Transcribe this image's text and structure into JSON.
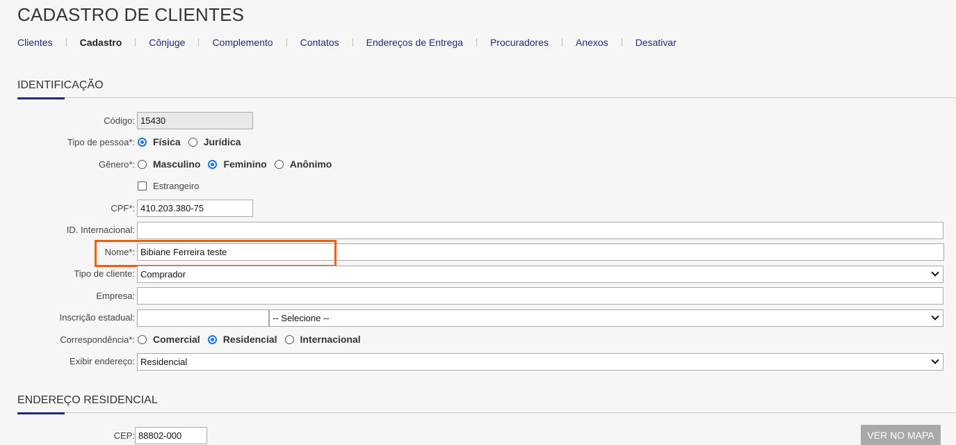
{
  "page": {
    "title": "CADASTRO DE CLIENTES"
  },
  "tabs": [
    {
      "label": "Clientes"
    },
    {
      "label": "Cadastro"
    },
    {
      "label": "Cônjuge"
    },
    {
      "label": "Complemento"
    },
    {
      "label": "Contatos"
    },
    {
      "label": "Endereços de Entrega"
    },
    {
      "label": "Procuradores"
    },
    {
      "label": "Anexos"
    },
    {
      "label": "Desativar"
    }
  ],
  "active_tab": "Cadastro",
  "identificacao": {
    "title": "IDENTIFICAÇÃO",
    "codigo": {
      "label": "Código:",
      "value": "15430"
    },
    "tipo_pessoa": {
      "label": "Tipo de pessoa*:",
      "options": [
        "Física",
        "Jurídica"
      ],
      "selected": "Física"
    },
    "genero": {
      "label": "Gênero*:",
      "options": [
        "Masculino",
        "Feminino",
        "Anônimo"
      ],
      "selected": "Feminino"
    },
    "estrangeiro": {
      "label": "Estrangeiro",
      "checked": false
    },
    "cpf": {
      "label": "CPF*:",
      "value": "410.203.380-75"
    },
    "id_internacional": {
      "label": "ID. Internacional:",
      "value": ""
    },
    "nome": {
      "label": "Nome*:",
      "value": "Bibiane Ferreira teste"
    },
    "tipo_cliente": {
      "label": "Tipo de cliente:",
      "value": "Comprador"
    },
    "empresa": {
      "label": "Empresa:",
      "value": ""
    },
    "inscricao_estadual": {
      "label": "Inscrição estadual:",
      "value": "",
      "select_value": "-- Selecione --"
    },
    "correspondencia": {
      "label": "Correspondência*:",
      "options": [
        "Comercial",
        "Residencial",
        "Internacional"
      ],
      "selected": "Residencial"
    },
    "exibir_endereco": {
      "label": "Exibir endereço:",
      "value": "Residencial"
    }
  },
  "endereco_residencial": {
    "title": "ENDEREÇO RESIDENCIAL",
    "cep": {
      "label": "CEP:",
      "value": "88802-000"
    },
    "ver_mapa_label": "VER NO MAPA"
  },
  "colors": {
    "accent": "#23297a",
    "highlight": "#f25c05",
    "radio_checked": "#1a73e8"
  }
}
